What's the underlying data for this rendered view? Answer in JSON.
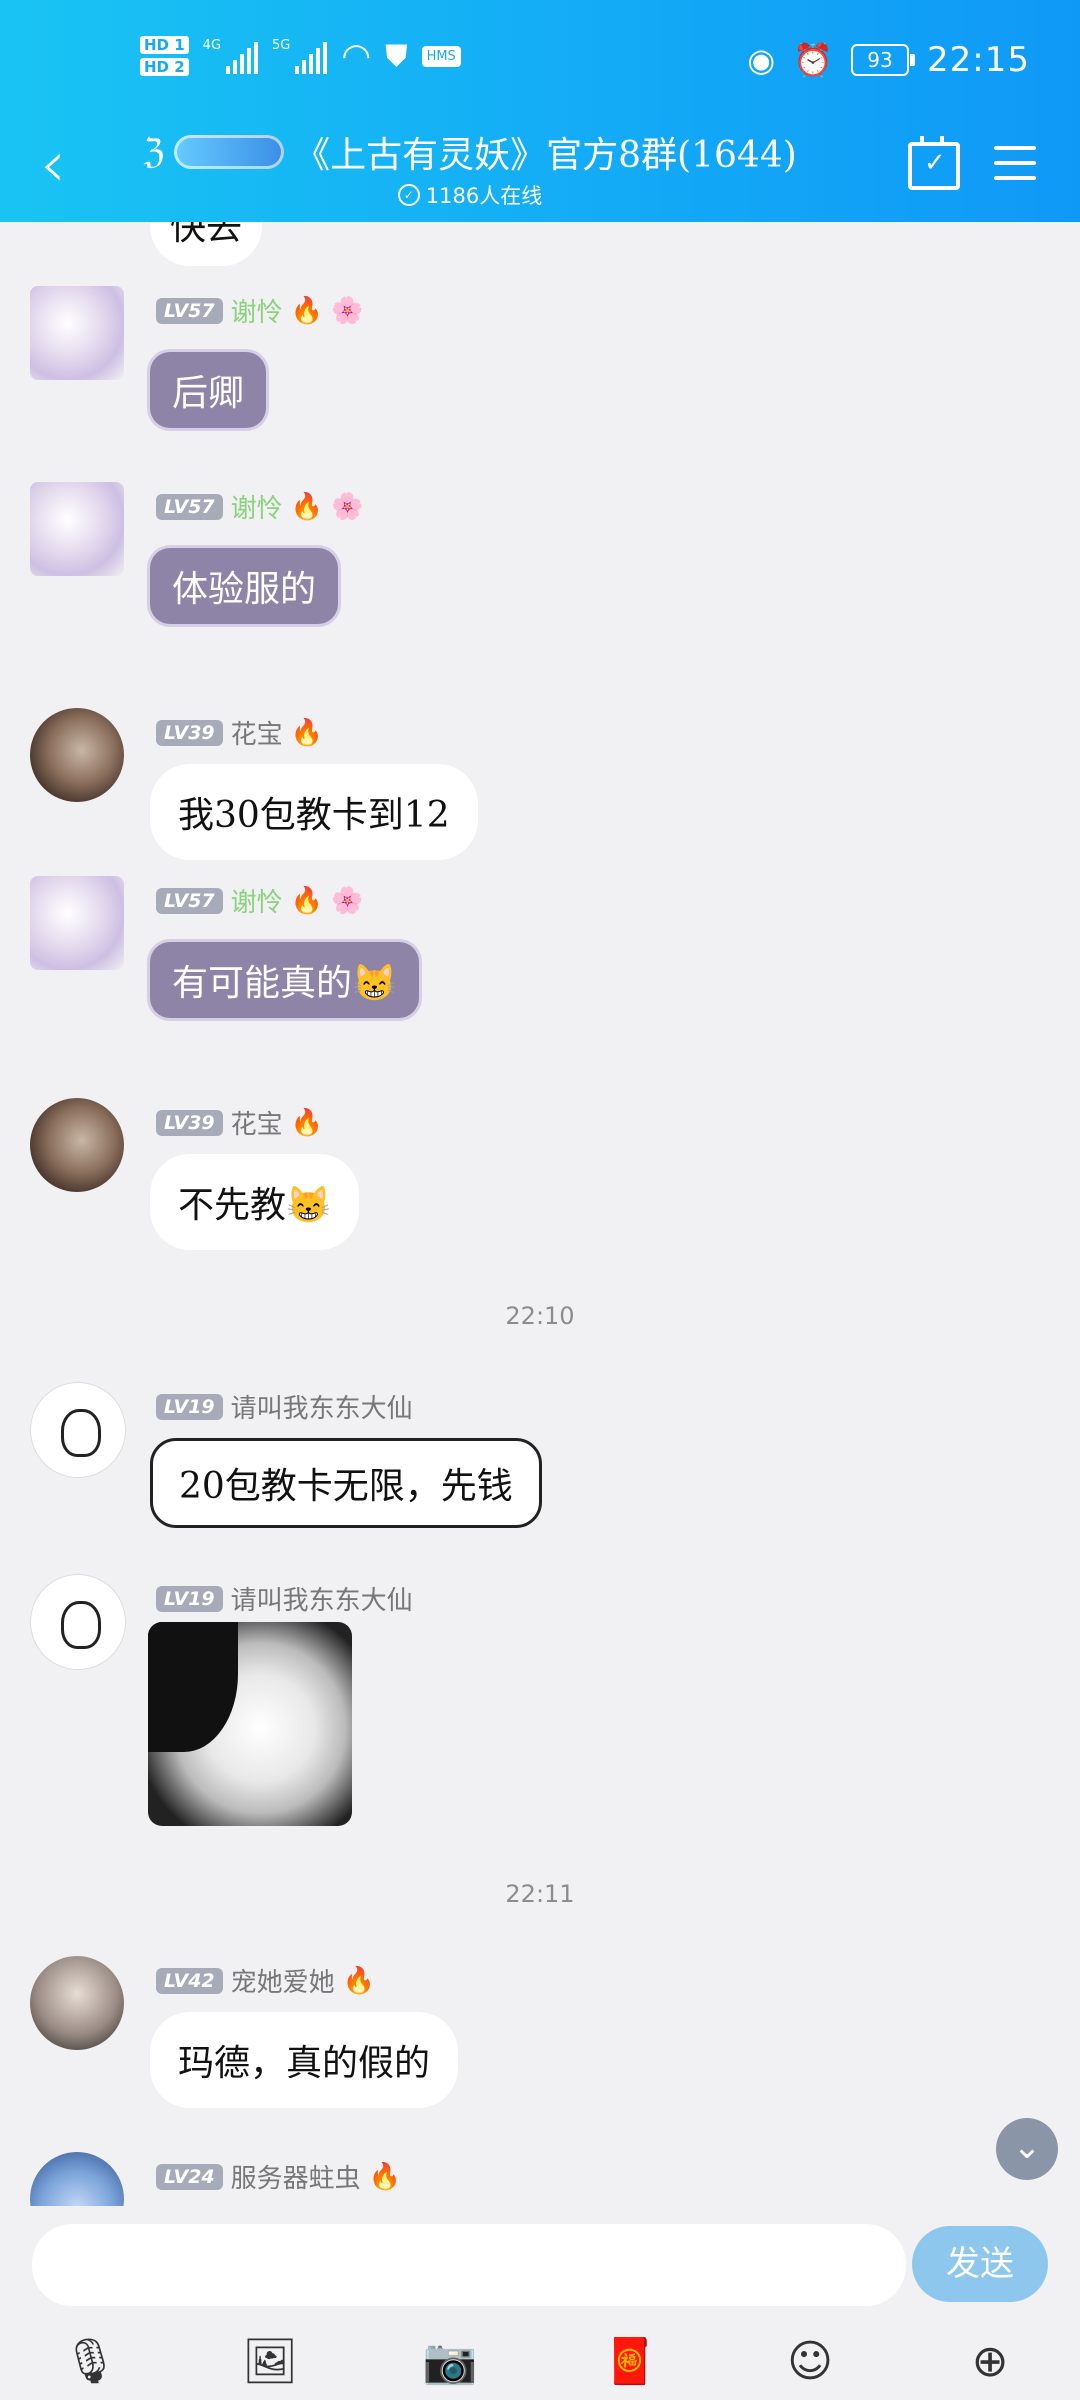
{
  "status_bar": {
    "left_badges": [
      "HD 1",
      "HD 2"
    ],
    "net1": "4G",
    "net2": "5G",
    "hms": "HMS",
    "battery": "93",
    "time": "22:15"
  },
  "header": {
    "back_icon": "‹",
    "title": "《上古有灵妖》官方8群(1644)",
    "online": "1186人在线"
  },
  "messages": [
    {
      "bubble": "快去"
    },
    {
      "level": "LV57",
      "name": "谢怜",
      "bubble": "后卿"
    },
    {
      "level": "LV57",
      "name": "谢怜",
      "bubble": "体验服的"
    },
    {
      "level": "LV39",
      "name": "花宝",
      "bubble": "我30包教卡到12"
    },
    {
      "level": "LV57",
      "name": "谢怜",
      "bubble": "有可能真的😸"
    },
    {
      "level": "LV39",
      "name": "花宝",
      "bubble": "不先教😸"
    },
    {
      "level": "LV19",
      "name": "请叫我东东大仙",
      "bubble": "20包教卡无限，先钱"
    },
    {
      "level": "LV19",
      "name": "请叫我东东大仙"
    },
    {
      "level": "LV42",
      "name": "宠她爱她",
      "bubble": "玛德，真的假的"
    },
    {
      "level": "LV24",
      "name": "服务器蛀虫"
    }
  ],
  "timestamps": [
    "22:10",
    "22:11"
  ],
  "input": {
    "placeholder": "",
    "send_label": "发送"
  },
  "icons": {
    "mic": "microphone-icon",
    "photo": "photo-icon",
    "camera": "camera-icon",
    "red_packet": "red-packet-icon",
    "emoji": "emoji-icon",
    "plus": "plus-icon"
  }
}
